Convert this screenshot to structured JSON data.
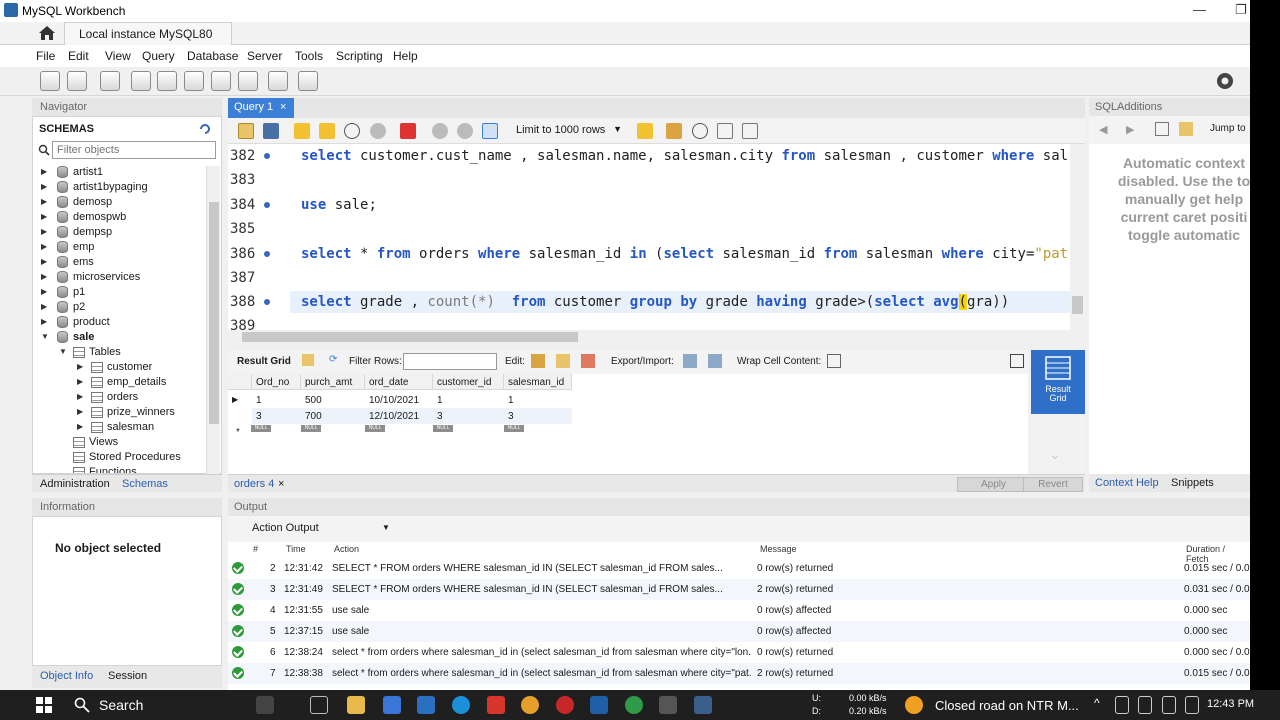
{
  "window": {
    "title": "MySQL Workbench",
    "connection_tab": "Local instance MySQL80",
    "minimize": "—",
    "restore": "❐"
  },
  "menu": [
    "File",
    "Edit",
    "View",
    "Query",
    "Database",
    "Server",
    "Tools",
    "Scripting",
    "Help"
  ],
  "navigator": {
    "header": "Navigator",
    "schemas_title": "SCHEMAS",
    "filter_placeholder": "Filter objects",
    "tree": [
      "artist1",
      "artist1bypaging",
      "demosp",
      "demospwb",
      "dempsp",
      "emp",
      "ems",
      "microservices",
      "p1",
      "p2",
      "product",
      "sale"
    ],
    "sale_children": {
      "tables_label": "Tables",
      "tables": [
        "customer",
        "emp_details",
        "orders",
        "prize_winners",
        "salesman"
      ],
      "views": "Views",
      "stored_procedures": "Stored Procedures",
      "functions": "Functions"
    },
    "tabs": {
      "administration": "Administration",
      "schemas": "Schemas"
    }
  },
  "information": {
    "header": "Information",
    "no_object": "No object selected",
    "tabs": {
      "object_info": "Object Info",
      "session": "Session"
    }
  },
  "query_tab": {
    "label": "Query 1",
    "close": "×",
    "limit_rows": "Limit to 1000 rows"
  },
  "editor": {
    "lines": [
      {
        "num": "382",
        "dot": true
      },
      {
        "num": "383",
        "dot": false
      },
      {
        "num": "384",
        "dot": true
      },
      {
        "num": "385",
        "dot": false
      },
      {
        "num": "386",
        "dot": true
      },
      {
        "num": "387",
        "dot": false
      },
      {
        "num": "388",
        "dot": true
      },
      {
        "num": "389",
        "dot": false
      }
    ],
    "code": {
      "l382": {
        "kw1": "select",
        "t1": " customer.cust_name , salesman.name, salesman.city ",
        "kw2": "from",
        "t2": " salesman , customer ",
        "kw3": "where",
        "t3": " sal"
      },
      "l384": {
        "kw1": "use",
        "t1": " sale;"
      },
      "l386": {
        "kw1": "select",
        "t1": " * ",
        "kw2": "from",
        "t2": " orders ",
        "kw3": "where",
        "t3": " salesman_id ",
        "kw4": "in",
        "t4": " (",
        "kw5": "select",
        "t5": " salesman_id ",
        "kw6": "from",
        "t6": " salesman ",
        "kw7": "where",
        "t7": " city=",
        "s1": "\"pat"
      },
      "l388": {
        "kw1": "select",
        "t1": " grade , ",
        "f1": "count(*)",
        "t2": "  ",
        "kw2": "from",
        "t3": " customer ",
        "kw3": "group",
        "t4": " ",
        "kw4": "by",
        "t5": " grade ",
        "kw5": "having",
        "t6": " grade>(",
        "kw6": "select",
        "t7": " ",
        "kw7": "avg",
        "h1": "(",
        "t8": "gra))"
      }
    }
  },
  "result_grid": {
    "label": "Result Grid",
    "filter_rows": "Filter Rows:",
    "edit": "Edit:",
    "export_import": "Export/Import:",
    "wrap": "Wrap Cell Content:",
    "columns": [
      "Ord_no",
      "purch_amt",
      "ord_date",
      "customer_id",
      "salesman_id"
    ],
    "rows": [
      [
        "1",
        "500",
        "10/10/2021",
        "1",
        "1"
      ],
      [
        "3",
        "700",
        "12/10/2021",
        "3",
        "3"
      ]
    ],
    "null_label": "NULL",
    "side_button": "Result\nGrid",
    "tab": "orders 4",
    "apply": "Apply",
    "revert": "Revert"
  },
  "sql_additions": {
    "header": "SQLAdditions",
    "jump_to": "Jump to",
    "help_text": [
      "Automatic context",
      "disabled. Use the to",
      "manually get help",
      "current caret positi",
      "toggle automatic"
    ],
    "tabs": {
      "context_help": "Context Help",
      "snippets": "Snippets"
    }
  },
  "output": {
    "header": "Output",
    "selector": "Action Output",
    "columns": {
      "num": "#",
      "time": "Time",
      "action": "Action",
      "message": "Message",
      "duration": "Duration / Fetch"
    },
    "rows": [
      {
        "n": "2",
        "time": "12:31:42",
        "action": "SELECT * FROM orders WHERE salesman_id IN      (SELECT salesman_id             FROM sales...",
        "message": "0 row(s) returned",
        "duration": "0.015 sec / 0.0"
      },
      {
        "n": "3",
        "time": "12:31:49",
        "action": "SELECT * FROM orders WHERE salesman_id IN      (SELECT salesman_id             FROM sales...",
        "message": "2 row(s) returned",
        "duration": "0.031 sec / 0.0"
      },
      {
        "n": "4",
        "time": "12:31:55",
        "action": "use sale",
        "message": "0 row(s) affected",
        "duration": "0.000 sec"
      },
      {
        "n": "5",
        "time": "12:37:15",
        "action": "use sale",
        "message": "0 row(s) affected",
        "duration": "0.000 sec"
      },
      {
        "n": "6",
        "time": "12:38:24",
        "action": "select * from orders where salesman_id in (select salesman_id from salesman where city=\"lon...",
        "message": "0 row(s) returned",
        "duration": "0.000 sec / 0.0"
      },
      {
        "n": "7",
        "time": "12:38:38",
        "action": "select * from orders where salesman_id in (select salesman_id from salesman where city=\"pat...",
        "message": "2 row(s) returned",
        "duration": "0.015 sec / 0.0"
      }
    ]
  },
  "taskbar": {
    "search": "Search",
    "net_u": "U:",
    "net_d": "D:",
    "up_speed": "0.00 kB/s",
    "down_speed": "0.20 kB/s",
    "news": "Closed road on NTR M...",
    "clock": "12:43 PM"
  }
}
